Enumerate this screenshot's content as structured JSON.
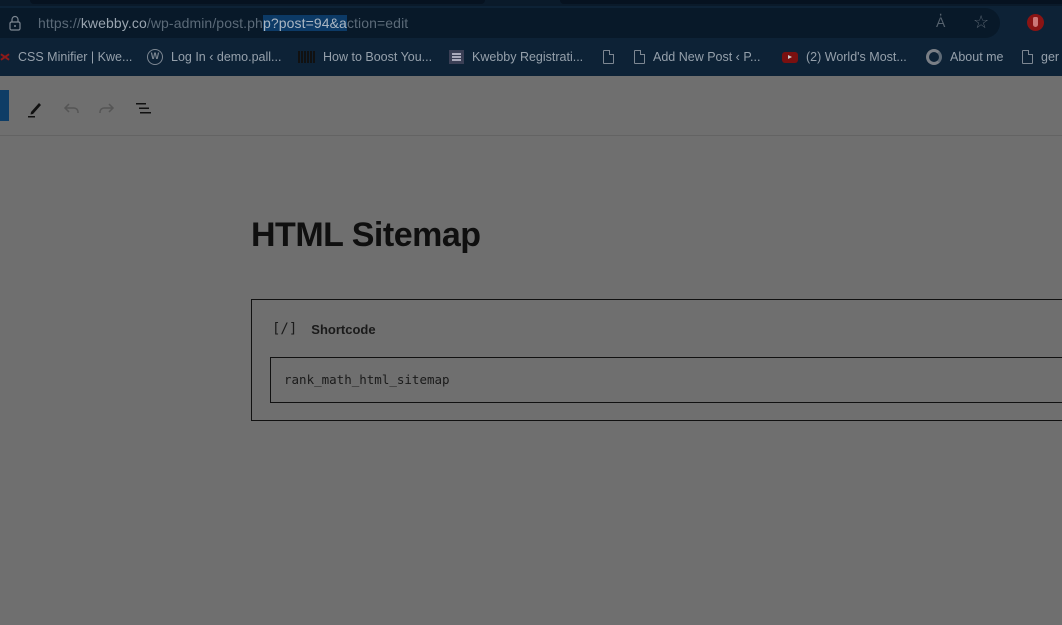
{
  "browser": {
    "url": {
      "scheme": "https://",
      "host": "kwebby.co",
      "path_before_selection": "/wp-admin/post.ph",
      "selected": "p?post=94&a",
      "path_after_selection": "ction=edit"
    },
    "icons": {
      "lock": "lock-icon",
      "read_aloud": "read-aloud-icon",
      "favorite": "star-icon",
      "extension": "hand-extension-icon"
    },
    "read_aloud_glyph": "A҆",
    "star_glyph": "☆",
    "bookmarks": [
      {
        "label": "CSS Minifier | Kwe...",
        "icon": "red-x-icon"
      },
      {
        "label": "Log In ‹ demo.pall...",
        "icon": "wordpress-icon"
      },
      {
        "label": "How to Boost You...",
        "icon": "barcode-icon"
      },
      {
        "label": "Kwebby Registrati...",
        "icon": "list-icon"
      },
      {
        "label": "",
        "icon": "document-icon"
      },
      {
        "label": "Add New Post ‹ P...",
        "icon": "document-icon"
      },
      {
        "label": "(2) World's Most...",
        "icon": "youtube-icon"
      },
      {
        "label": "About me",
        "icon": "google-icon"
      },
      {
        "label": "ger",
        "icon": "document-icon"
      }
    ]
  },
  "editor": {
    "toolbar": {
      "tools": [
        "edit-tool",
        "undo",
        "redo",
        "document-overview"
      ]
    },
    "post_title": "HTML Sitemap",
    "block": {
      "icon_glyph": "[/]",
      "label": "Shortcode",
      "value": "rank_math_html_sitemap"
    }
  },
  "colors": {
    "overlay": "#6f6f6f",
    "chrome_bg": "#0d2236",
    "url_selection": "#0c3a66"
  }
}
